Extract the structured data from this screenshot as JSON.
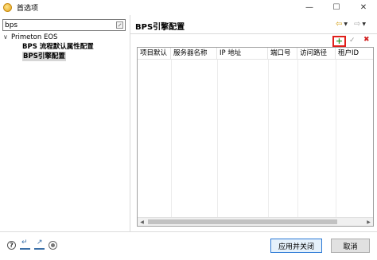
{
  "window": {
    "title": "首选项",
    "controls": {
      "minimize": "—",
      "maximize": "☐",
      "close": "✕"
    }
  },
  "sidebar": {
    "search_value": "bps",
    "tree": {
      "root_label": "Primeton EOS",
      "root_expander": "∨",
      "children": [
        {
          "label": "BPS 流程默认属性配置",
          "selected": false
        },
        {
          "label": "BPS引擎配置",
          "selected": true
        }
      ]
    }
  },
  "main": {
    "title": "BPS引擎配置",
    "nav": {
      "back": "⇦",
      "forward": "⇨",
      "dropdown": "▼"
    },
    "toolbar": {
      "add": "+",
      "edit": "✓",
      "delete": "✖"
    },
    "table": {
      "columns": [
        "项目默认",
        "服务器名称",
        "IP 地址",
        "端口号",
        "访问路径",
        "租户ID"
      ],
      "rows": []
    },
    "scroll": {
      "left": "◀",
      "right": "▶"
    }
  },
  "footer": {
    "help": "?",
    "apply_close_label": "应用并关闭",
    "cancel_label": "取消"
  },
  "colors": {
    "highlight": "#e0201b",
    "add_icon": "#2e9c2e",
    "delete_icon": "#d21f1f",
    "primary_border": "#2c7ad6"
  }
}
